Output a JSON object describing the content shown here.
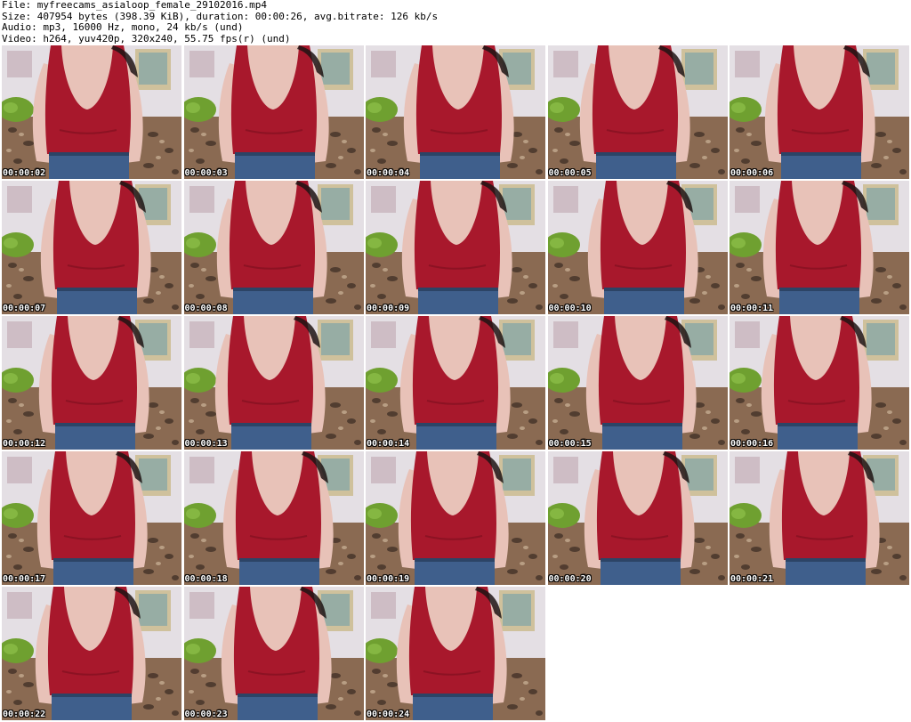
{
  "header": {
    "file_line": "File: myfreecams_asialoop_female_29102016.mp4",
    "size_line": "Size: 407954 bytes (398.39 KiB), duration: 00:00:26, avg.bitrate: 126 kb/s",
    "audio_line": "Audio: mp3, 16000 Hz, mono, 24 kb/s (und)",
    "video_line": "Video: h264, yuv420p, 320x240, 55.75 fps(r) (und)"
  },
  "thumbnails": [
    {
      "timestamp": "00:00:02"
    },
    {
      "timestamp": "00:00:03"
    },
    {
      "timestamp": "00:00:04"
    },
    {
      "timestamp": "00:00:05"
    },
    {
      "timestamp": "00:00:06"
    },
    {
      "timestamp": "00:00:07"
    },
    {
      "timestamp": "00:00:08"
    },
    {
      "timestamp": "00:00:09"
    },
    {
      "timestamp": "00:00:10"
    },
    {
      "timestamp": "00:00:11"
    },
    {
      "timestamp": "00:00:12"
    },
    {
      "timestamp": "00:00:13"
    },
    {
      "timestamp": "00:00:14"
    },
    {
      "timestamp": "00:00:15"
    },
    {
      "timestamp": "00:00:16"
    },
    {
      "timestamp": "00:00:17"
    },
    {
      "timestamp": "00:00:18"
    },
    {
      "timestamp": "00:00:19"
    },
    {
      "timestamp": "00:00:20"
    },
    {
      "timestamp": "00:00:21"
    },
    {
      "timestamp": "00:00:22"
    },
    {
      "timestamp": "00:00:23"
    },
    {
      "timestamp": "00:00:24"
    }
  ],
  "colors": {
    "tank_top": "#a8182c",
    "skin": "#e8c2b8",
    "denim": "#3f5f8c",
    "wall": "#e4dfe4",
    "leopard": "#8a6a52",
    "pillow": "#6fa030"
  }
}
